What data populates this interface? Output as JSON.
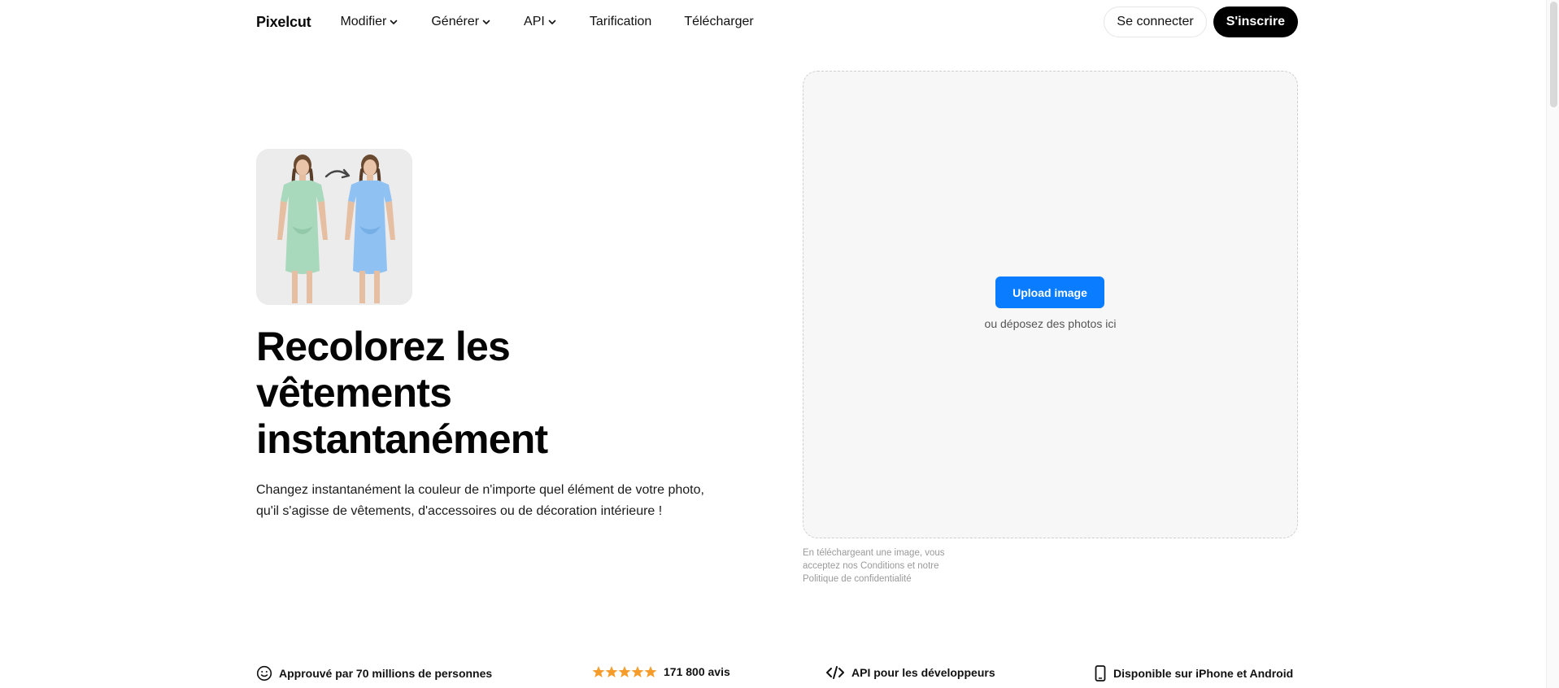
{
  "nav": {
    "logo": "Pixelcut",
    "links": [
      {
        "label": "Modifier",
        "dropdown": true
      },
      {
        "label": "Générer",
        "dropdown": true
      },
      {
        "label": "API",
        "dropdown": true
      },
      {
        "label": "Tarification",
        "dropdown": false
      },
      {
        "label": "Télécharger",
        "dropdown": false
      }
    ],
    "login_label": "Se connecter",
    "signup_label": "S'inscrire"
  },
  "hero": {
    "title": "Recolorez les vêtements instantanément",
    "subtitle": "Changez instantanément la couleur de n'importe quel élément de votre photo, qu'il s'agisse de vêtements, d'accessoires ou de décoration intérieure !",
    "image_icon": "recolor-example-image"
  },
  "upload": {
    "button_label": "Upload image",
    "hint": "ou déposez des photos ici",
    "terms": "En téléchargeant une image, vous acceptez nos Conditions et notre Politique de confidentialité"
  },
  "features": [
    {
      "icon": "smile-icon",
      "label": "Approuvé par 70 millions de personnes"
    },
    {
      "icon": "stars-icon",
      "label": "171 800 avis",
      "stars": 5
    },
    {
      "icon": "code-icon",
      "label": "API pour les développeurs"
    },
    {
      "icon": "phone-icon",
      "label": "Disponible sur iPhone et Android"
    }
  ],
  "colors": {
    "accent": "#0a7cff",
    "star": "#f59c2b",
    "text": "#0b0b0b"
  }
}
